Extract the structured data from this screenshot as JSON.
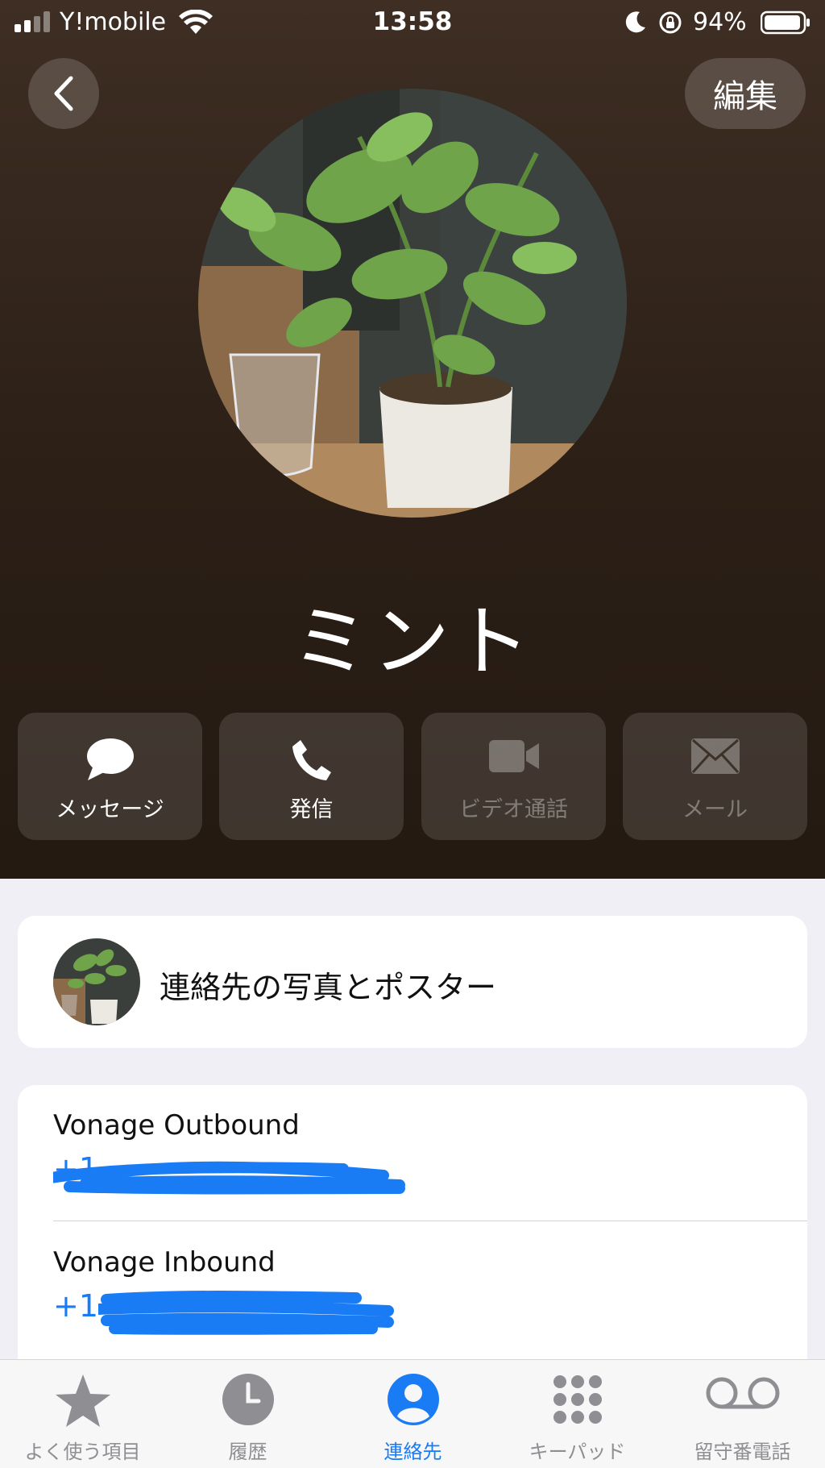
{
  "status_bar": {
    "carrier": "Y!mobile",
    "time": "13:58",
    "battery_percent": "94%",
    "signal_bars": 2,
    "battery_level": 0.94
  },
  "nav": {
    "edit_label": "編集"
  },
  "contact": {
    "name": "ミント"
  },
  "actions": [
    {
      "label": "メッセージ",
      "icon": "message-icon",
      "enabled": true
    },
    {
      "label": "発信",
      "icon": "phone-icon",
      "enabled": true
    },
    {
      "label": "ビデオ通話",
      "icon": "video-icon",
      "enabled": false
    },
    {
      "label": "メール",
      "icon": "mail-icon",
      "enabled": false
    }
  ],
  "photo_poster": {
    "label": "連絡先の写真とポスター"
  },
  "phones": [
    {
      "label": "Vonage Outbound",
      "number_visible": "+1"
    },
    {
      "label": "Vonage Inbound",
      "number_visible": "+1"
    }
  ],
  "tabs": [
    {
      "label": "よく使う項目",
      "icon": "star-icon",
      "active": false
    },
    {
      "label": "履歴",
      "icon": "clock-icon",
      "active": false
    },
    {
      "label": "連絡先",
      "icon": "person-circle-icon",
      "active": true
    },
    {
      "label": "キーパッド",
      "icon": "keypad-icon",
      "active": false
    },
    {
      "label": "留守番電話",
      "icon": "voicemail-icon",
      "active": false
    }
  ],
  "colors": {
    "accent": "#1a7cf5",
    "header_top": "#3e2e24",
    "header_bottom": "#241a12",
    "background": "#efeff5"
  }
}
